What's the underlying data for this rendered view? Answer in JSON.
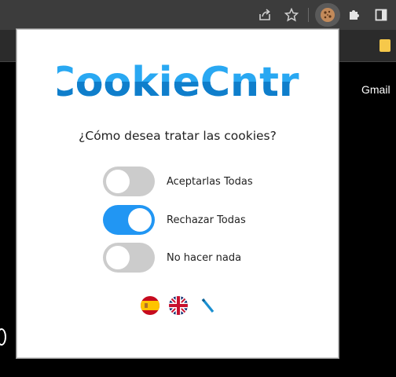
{
  "app": {
    "name": "CookieCntrl"
  },
  "browser": {
    "bookmark_link": "Gmail",
    "icons": [
      "share-icon",
      "star-icon",
      "cookie-extension-icon",
      "puzzle-icon",
      "side-panel-icon"
    ]
  },
  "popup": {
    "question": "¿Cómo desea tratar las cookies?",
    "options": [
      {
        "label": "Aceptarlas Todas",
        "selected": false
      },
      {
        "label": "Rechazar Todas",
        "selected": true
      },
      {
        "label": "No hacer nada",
        "selected": false
      }
    ],
    "languages": [
      "es-flag-icon",
      "uk-flag-icon",
      "pencil-icon"
    ]
  },
  "colors": {
    "brand": "#29a8f2",
    "toggle_on": "#2196f3",
    "toggle_off": "#cccccc"
  }
}
